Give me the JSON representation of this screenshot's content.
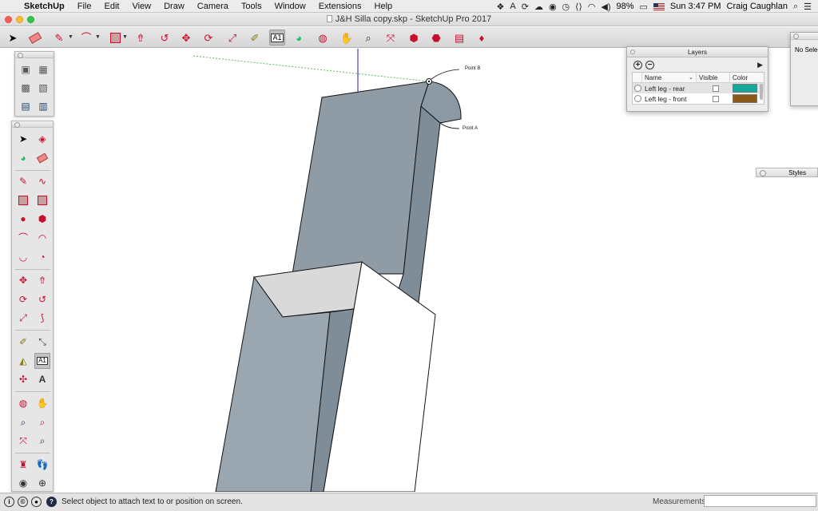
{
  "menubar": {
    "app_name": "SketchUp",
    "menus": [
      "File",
      "Edit",
      "View",
      "Draw",
      "Camera",
      "Tools",
      "Window",
      "Extensions",
      "Help"
    ],
    "battery": "98%",
    "clock": "Sun 3:47 PM",
    "user": "Craig Caughlan"
  },
  "window": {
    "title": "J&H Silla copy.skp - SketchUp Pro 2017"
  },
  "annotations": {
    "point_b": "Point B",
    "point_a": "Point A"
  },
  "layers": {
    "title": "Layers",
    "add": "+",
    "remove": "−",
    "columns": {
      "name": "Name",
      "visible": "Visible",
      "color": "Color"
    },
    "rows": [
      {
        "name": "Left leg - rear",
        "color": "#14a89b",
        "selected": true
      },
      {
        "name": "Left leg - front",
        "color": "#8a5a1a",
        "selected": false
      }
    ]
  },
  "entity_info": {
    "text": "No Selection"
  },
  "styles": {
    "title": "Styles"
  },
  "statusbar": {
    "message": "Select object to attach text to or position on screen.",
    "measurements_label": "Measurements",
    "measurements_value": ""
  },
  "icons": {
    "select": "arrow-icon",
    "eraser": "eraser-icon",
    "pencil": "pencil-icon",
    "arc": "arc-icon",
    "rectangle": "rectangle-icon",
    "push_pull": "push-pull-icon",
    "follow_me": "follow-me-icon",
    "move": "move-icon",
    "rotate": "rotate-icon",
    "scale": "scale-icon",
    "tape": "tape-measure-icon",
    "text": "text-tool-icon",
    "paint": "paint-bucket-icon",
    "orbit": "orbit-icon",
    "pan": "pan-icon",
    "zoom": "zoom-icon",
    "zoom_extents": "zoom-extents-icon",
    "warehouse": "warehouse-icon",
    "extension": "extension-warehouse-icon",
    "send": "send-to-layout-icon",
    "ruby": "ruby-icon"
  },
  "colors": {
    "face_front": "#9aa7b1",
    "face_side": "#7e8d98",
    "face_top": "#d9d9d9",
    "axis_blue": "#1a1aa8",
    "axis_green_dotted": "#57c44f",
    "accent_red": "#c8102e"
  }
}
